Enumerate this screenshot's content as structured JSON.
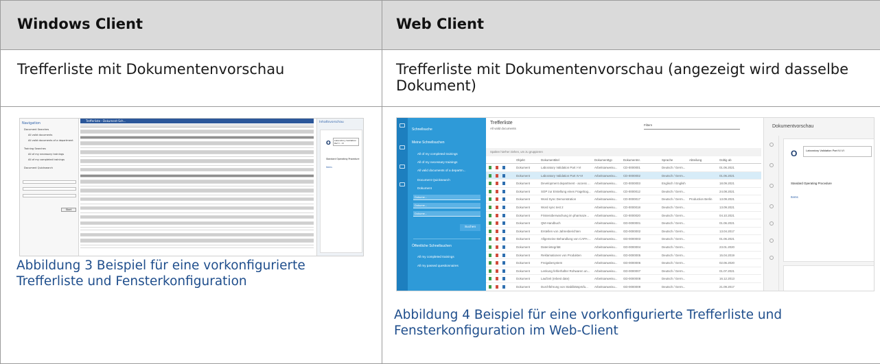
{
  "table": {
    "headers": [
      "Windows Client",
      "Web Client"
    ],
    "descriptions": [
      "Trefferliste mit Dokumentenvorschau",
      "Trefferliste mit Dokumentenvorschau (angezeigt wird dasselbe Dokument)"
    ],
    "captions": [
      "Abbildung 3 Beispiel für eine vorkonfigurierte Trefferliste und Fensterkonfiguration",
      "Abbildung 4 Beispiel für eine vorkonfigurierte Trefferliste und Fensterkonfiguration im Web-Client"
    ]
  },
  "windows_client": {
    "nav_title": "Navigation",
    "nav_items": [
      "Document Searches",
      "All valid documents",
      "All valid documents of a department",
      "Training Searches",
      "All of my necessary trainings",
      "All of my completed trainings",
      "Document Quicksearch"
    ],
    "search_button": "Start",
    "list_tab": "Trefferliste - Dokument-Sch...",
    "preview_title": "Inhaltsvorschau",
    "doc_title": "Laboratory Validation Part I - VI",
    "doc_sop": "Standard Operating Procedure",
    "doc_body": "Items",
    "logo": "O"
  },
  "web_client": {
    "sidebar": {
      "quicksearch": "Schnellsuche",
      "my_searches": "Meine Schnellsuchen",
      "items": [
        "All of my completed trainings",
        "All of my necessary trainings",
        "All valid documents of a departm...",
        "Document Quicksearch"
      ],
      "doc_label": "Dokument",
      "fields": [
        "Dokume...",
        "Dokume...",
        "Dokume..."
      ],
      "search_button": "Suchen",
      "public_searches": "Öffentliche Schnellsuchen",
      "public_items": [
        "All my completed trainings",
        "All my passed questionnaires"
      ]
    },
    "main": {
      "title": "Trefferliste",
      "subtitle": "All valid documents",
      "filter": "Filtern",
      "group_hint": "Spalten hierher ziehen, um zu gruppieren",
      "columns": [
        "Objekt",
        "Dokumenttitel",
        "Dokumenttyp",
        "Dokumentnr.",
        "Sprache",
        "Abteilung",
        "Gültig ab"
      ],
      "rows": [
        {
          "obj": "Dokument",
          "title": "Laboratory Validation Part I-VI",
          "type": "Arbeitsanweisu...",
          "nr": "CD-0000001",
          "lang": "Deutsch / Germ...",
          "dept": "",
          "date": "01.06.2021"
        },
        {
          "obj": "Dokument",
          "title": "Laboratory Validation Part IV-VI",
          "type": "Arbeitsanweisu...",
          "nr": "CD-0000002",
          "lang": "Deutsch / Germ...",
          "dept": "",
          "date": "01.06.2021"
        },
        {
          "obj": "Dokument",
          "title": "Development department - access ...",
          "type": "Arbeitsanweisu...",
          "nr": "CD-0000003",
          "lang": "Englisch / English",
          "dept": "",
          "date": "18.09.2021"
        },
        {
          "obj": "Dokument",
          "title": "SOP zur Erstellung eines Fragebog...",
          "type": "Arbeitsanweisu...",
          "nr": "CD-0000012",
          "lang": "Deutsch / Germ...",
          "dept": "",
          "date": "24.08.2021"
        },
        {
          "obj": "Dokument",
          "title": "Word Sync Demonstration",
          "type": "Arbeitsanweisu...",
          "nr": "CD-0000017",
          "lang": "Deutsch / Germ...",
          "dept": "Production Berlin",
          "date": "13.09.2021"
        },
        {
          "obj": "Dokument",
          "title": "Word sync test 2",
          "type": "Arbeitsanweisu...",
          "nr": "CD-0000018",
          "lang": "Deutsch / Germ...",
          "dept": "",
          "date": "13.09.2021"
        },
        {
          "obj": "Dokument",
          "title": "Fristenüberwachung im pharmaze...",
          "type": "Arbeitsanweisu...",
          "nr": "CD-0000020",
          "lang": "Deutsch / Germ...",
          "dept": "",
          "date": "04.10.2021"
        },
        {
          "obj": "Dokument",
          "title": "QM-Handbuch",
          "type": "Arbeitsanweisu...",
          "nr": "GD-0000001",
          "lang": "Deutsch / Germ...",
          "dept": "",
          "date": "01.06.2021"
        },
        {
          "obj": "Dokument",
          "title": "Erstellen von Jahresberichten",
          "type": "Arbeitsanweisu...",
          "nr": "GD-0000002",
          "lang": "Deutsch / Germ...",
          "dept": "",
          "date": "13.04.2017"
        },
        {
          "obj": "Dokument",
          "title": "Allgemeine Behandlung von CAPA-...",
          "type": "Arbeitsanweisu...",
          "nr": "GD-0000003",
          "lang": "Deutsch / Germ...",
          "dept": "",
          "date": "01.06.2021"
        },
        {
          "obj": "Dokument",
          "title": "Datenintegrität",
          "type": "Arbeitsanweisu...",
          "nr": "GD-0000004",
          "lang": "Deutsch / Germ...",
          "dept": "",
          "date": "23.01.2020"
        },
        {
          "obj": "Dokument",
          "title": "Reklamationen von Produkten",
          "type": "Arbeitsanweisu...",
          "nr": "GD-0000005",
          "lang": "Deutsch / Germ...",
          "dept": "",
          "date": "15.04.2019"
        },
        {
          "obj": "Dokument",
          "title": "Freigabesystem",
          "type": "Arbeitsanweisu...",
          "nr": "GD-0000006",
          "lang": "Deutsch / Germ...",
          "dept": "",
          "date": "02.06.2020"
        },
        {
          "obj": "Dokument",
          "title": "Lenkung fehlerhafter Rohwaren un...",
          "type": "Arbeitsanweisu...",
          "nr": "GD-0000007",
          "lang": "Deutsch / Germ...",
          "dept": "",
          "date": "01.07.2021"
        },
        {
          "obj": "Dokument",
          "title": "Laufzeit (rebest date)",
          "type": "Arbeitsanweisu...",
          "nr": "GD-0000008",
          "lang": "Deutsch / Germ...",
          "dept": "",
          "date": "16.12.2013"
        },
        {
          "obj": "Dokument",
          "title": "Durchführung von Stabilitätsprüfu...",
          "type": "Arbeitsanweisu...",
          "nr": "GD-0000009",
          "lang": "Deutsch / Germ...",
          "dept": "",
          "date": "21.09.2017"
        }
      ]
    },
    "preview": {
      "title": "Dokumentvorschau",
      "doc_title": "Laboratory Validation Part IV-VI",
      "doc_sop": "Standard Operating Procedure",
      "doc_body": "Items",
      "logo": "O"
    }
  }
}
